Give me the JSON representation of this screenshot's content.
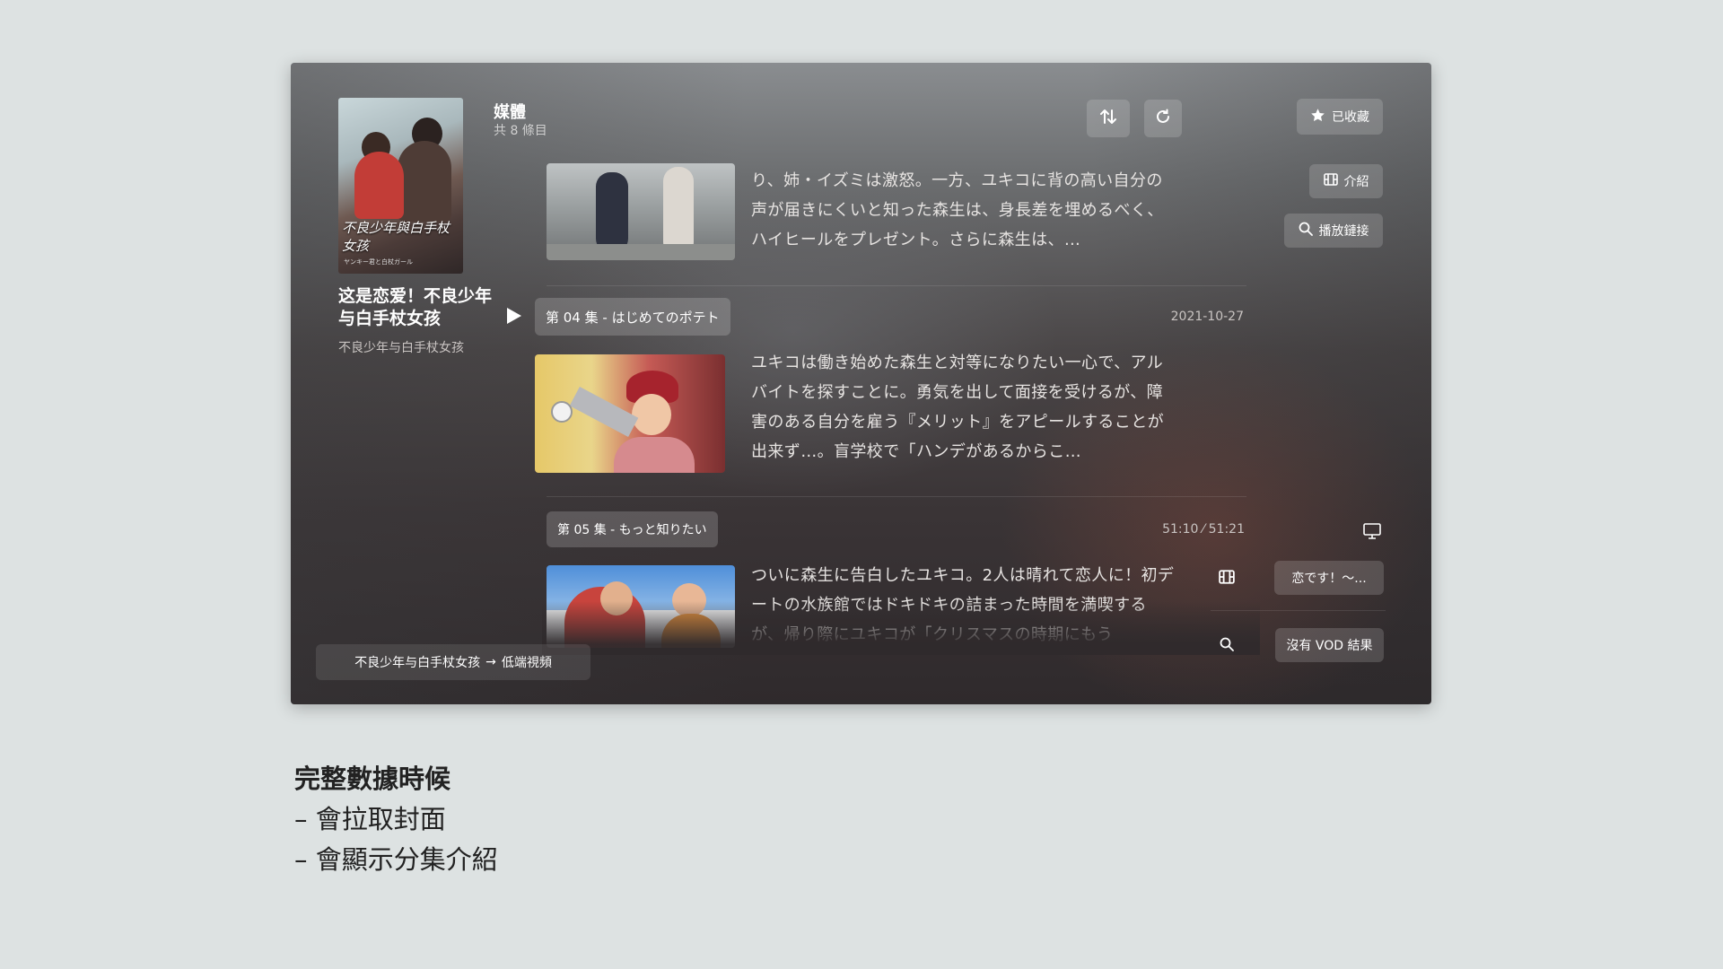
{
  "window": {
    "show": {
      "title": "这是恋爱！不良少年与白手杖女孩",
      "subtitle": "不良少年与白手杖女孩",
      "poster_text": "不良少年與白手杖女孩",
      "poster_small": "ヤンキー君と白杖ガール"
    },
    "header": {
      "title": "媒體",
      "count": "共 8 條目"
    },
    "toolbar": {
      "sort_icon": "sort-arrows-icon",
      "refresh_icon": "refresh-icon"
    },
    "side_actions": {
      "favorite": "已收藏",
      "intro": "介紹",
      "play_link": "播放鏈接"
    },
    "episodes": [
      {
        "text": "り、姉・イズミは激怒。一方、ユキコに背の高い自分の声が届きにくいと知った森生は、身長差を埋めるべく、ハイヒールをプレゼント。さらに森生は、…"
      },
      {
        "label": "第 04 集 - はじめてのポテト",
        "date": "2021-10-27",
        "text": "ユキコは働き始めた森生と対等になりたい一心で、アルバイトを探すことに。勇気を出して面接を受けるが、障害のある自分を雇う『メリット』をアピールすることが出来ず…。盲学校で「ハンデがあるからこ…"
      },
      {
        "label": "第 05 集 - もっと知りたい",
        "progress_text": "51:10 ⁄ 51:21",
        "text": "ついに森生に告白したユキコ。2人は晴れて恋人に！初デートの水族館ではドキドキの詰まった時間を満喫するが、帰り際にユキコが「クリスマスの時期にもう"
      }
    ],
    "right_panel": {
      "monitor_icon": "monitor-icon",
      "film_value": "恋です！～...",
      "search_value": "沒有 VOD 結果"
    },
    "footer_pill": {
      "source": "不良少年与白手杖女孩",
      "arrow": "→",
      "target": "低端視頻"
    }
  },
  "caption": {
    "title": "完整數據時候",
    "lines": [
      "– 會拉取封面",
      "– 會顯示分集介紹"
    ]
  }
}
